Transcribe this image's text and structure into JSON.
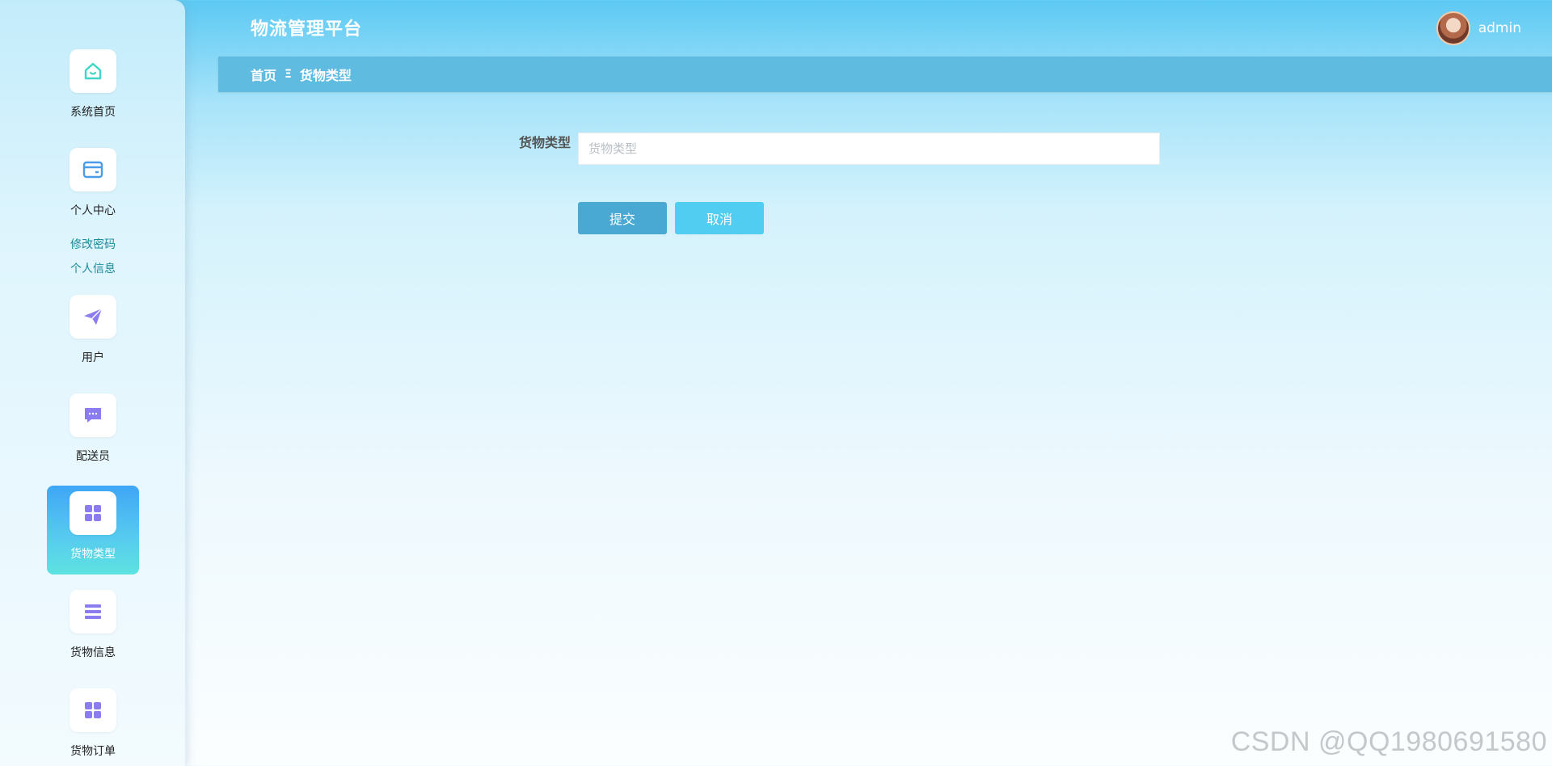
{
  "header": {
    "title": "物流管理平台",
    "username": "admin"
  },
  "breadcrumb": {
    "home": "首页",
    "separator": "Ξ",
    "current": "货物类型"
  },
  "sidebar": {
    "items": [
      {
        "label": "系统首页",
        "icon": "home-icon"
      },
      {
        "label": "个人中心",
        "icon": "card-icon"
      },
      {
        "label": "用户",
        "icon": "paper-plane-icon"
      },
      {
        "label": "配送员",
        "icon": "chat-icon"
      },
      {
        "label": "货物类型",
        "icon": "grid-icon",
        "active": true
      },
      {
        "label": "货物信息",
        "icon": "list-icon"
      },
      {
        "label": "货物订单",
        "icon": "grid-icon"
      }
    ],
    "sub_links": [
      "修改密码",
      "个人信息"
    ]
  },
  "form": {
    "field_label": "货物类型",
    "field_value": "",
    "field_placeholder": "货物类型",
    "submit_label": "提交",
    "cancel_label": "取消"
  },
  "watermark": "CSDN @QQ1980691580",
  "colors": {
    "accent": "#4aa9d3",
    "cancel": "#50cdf0",
    "icon_purple": "#8b7cf0",
    "icon_teal": "#3fd6c8",
    "icon_blue": "#4a9be8"
  }
}
